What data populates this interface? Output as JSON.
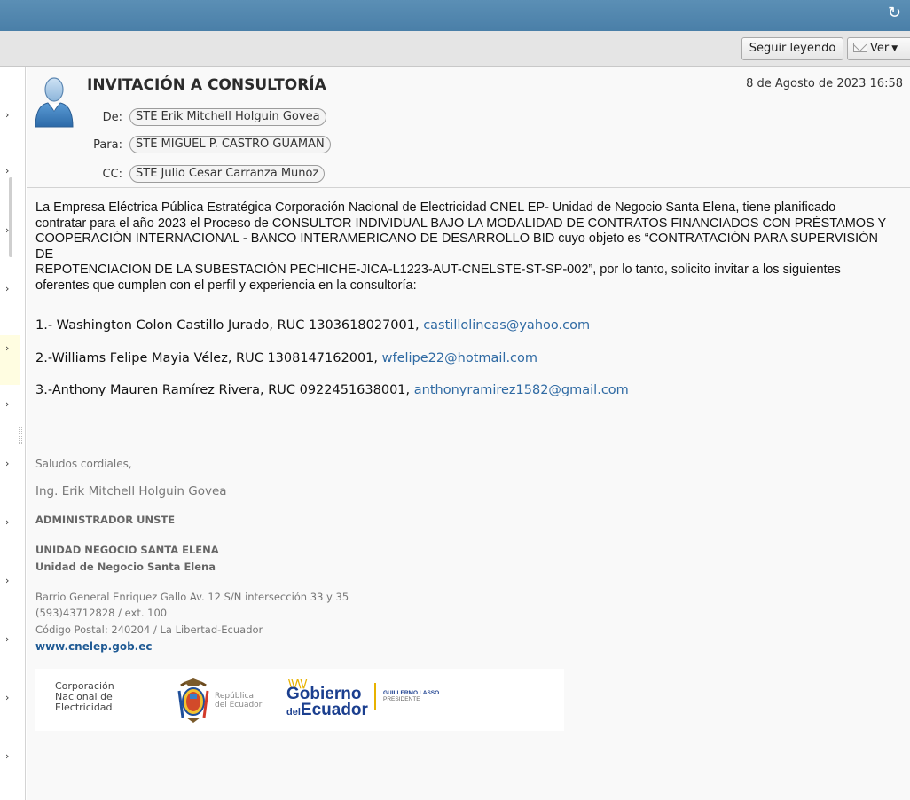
{
  "toolbar": {
    "seguir_label": "Seguir leyendo",
    "ver_label": "Ver"
  },
  "message": {
    "subject": "INVITACIÓN A CONSULTORÍA",
    "date": "8 de Agosto de 2023 16:58",
    "from_label": "De:",
    "from": "STE Erik Mitchell Holguin Govea",
    "to_label": "Para:",
    "to": "STE MIGUEL P. CASTRO GUAMAN",
    "cc_label": "CC:",
    "cc": "STE Julio Cesar Carranza Munoz"
  },
  "body": {
    "intro_lines": [
      "La Empresa Eléctrica Pública Estratégica Corporación Nacional de Electricidad CNEL EP- Unidad de Negocio Santa Elena, tiene planificado",
      "contratar para el año 2023 el Proceso de CONSULTOR INDIVIDUAL BAJO LA MODALIDAD DE CONTRATOS FINANCIADOS CON PRÉSTAMOS Y",
      "COOPERACIÓN INTERNACIONAL - BANCO INTERAMERICANO DE DESARROLLO BID cuyo objeto es “CONTRATACIÓN PARA SUPERVISIÓN DE",
      "REPOTENCIACION DE LA SUBESTACIÓN PECHICHE-JICA-L1223-AUT-CNELSTE-ST-SP-002”, por lo tanto, solicito invitar a los siguientes",
      "oferentes que cumplen con el perfil y experiencia en la consultoría:"
    ],
    "bidders": [
      {
        "text": "1.- Washington Colon Castillo Jurado, RUC 1303618027001, ",
        "email": "castillolineas@yahoo.com"
      },
      {
        "text": "2.-Williams Felipe Mayia Vélez, RUC 1308147162001, ",
        "email": "wfelipe22@hotmail.com"
      },
      {
        "text": "3.-Anthony Mauren Ramírez Rivera, RUC 0922451638001, ",
        "email": "anthonyramirez1582@gmail.com"
      }
    ]
  },
  "signature": {
    "greeting": "Saludos cordiales,",
    "name": "Ing. Erik Mitchell Holguin Govea",
    "role": "ADMINISTRADOR UNSTE",
    "unit_upper": "UNIDAD NEGOCIO SANTA ELENA",
    "unit": "Unidad de Negocio Santa Elena",
    "address": "Barrio General Enriquez Gallo Av. 12 S/N intersección 33 y 35",
    "phone": "(593)43712828 / ext. 100",
    "postal": "Código Postal: 240204 / La Libertad-Ecuador",
    "website": "www.cnelep.gob.ec"
  },
  "logos": {
    "cnel": [
      "Corporación",
      "Nacional de",
      "Electricidad"
    ],
    "republica": [
      "República",
      "del Ecuador"
    ],
    "gobierno_line1": "Gobierno",
    "gobierno_del": "del",
    "gobierno_line2": "Ecuador",
    "presidente_name": "GUILLERMO LASSO",
    "presidente_title": "PRESIDENTE"
  },
  "colors": {
    "topbar": "#4a7fa8",
    "link": "#2f6aa3",
    "gobierno_blue": "#1b3f8f",
    "gobierno_yellow": "#e8b200"
  }
}
